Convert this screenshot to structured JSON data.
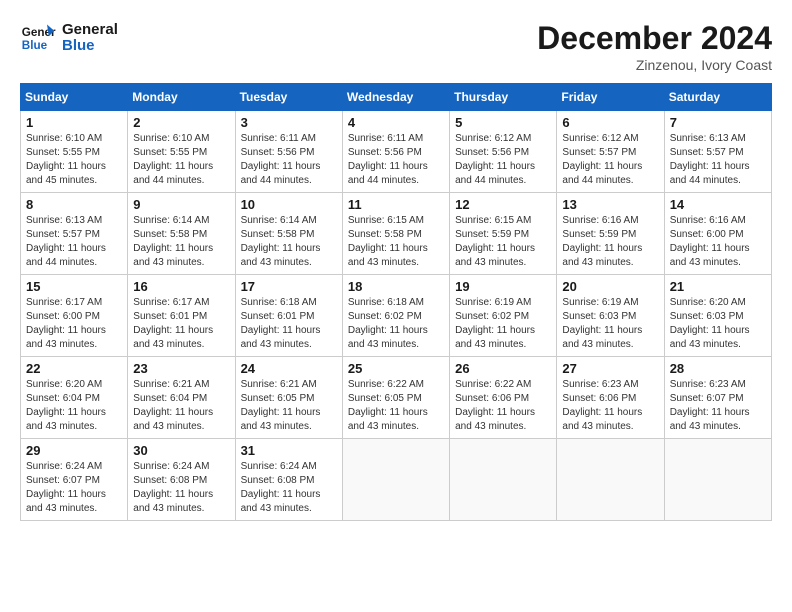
{
  "header": {
    "logo_line1": "General",
    "logo_line2": "Blue",
    "month_title": "December 2024",
    "subtitle": "Zinzenou, Ivory Coast"
  },
  "days_of_week": [
    "Sunday",
    "Monday",
    "Tuesday",
    "Wednesday",
    "Thursday",
    "Friday",
    "Saturday"
  ],
  "weeks": [
    [
      {
        "day": "1",
        "sunrise": "6:10 AM",
        "sunset": "5:55 PM",
        "daylight": "11 hours and 45 minutes."
      },
      {
        "day": "2",
        "sunrise": "6:10 AM",
        "sunset": "5:55 PM",
        "daylight": "11 hours and 44 minutes."
      },
      {
        "day": "3",
        "sunrise": "6:11 AM",
        "sunset": "5:56 PM",
        "daylight": "11 hours and 44 minutes."
      },
      {
        "day": "4",
        "sunrise": "6:11 AM",
        "sunset": "5:56 PM",
        "daylight": "11 hours and 44 minutes."
      },
      {
        "day": "5",
        "sunrise": "6:12 AM",
        "sunset": "5:56 PM",
        "daylight": "11 hours and 44 minutes."
      },
      {
        "day": "6",
        "sunrise": "6:12 AM",
        "sunset": "5:57 PM",
        "daylight": "11 hours and 44 minutes."
      },
      {
        "day": "7",
        "sunrise": "6:13 AM",
        "sunset": "5:57 PM",
        "daylight": "11 hours and 44 minutes."
      }
    ],
    [
      {
        "day": "8",
        "sunrise": "6:13 AM",
        "sunset": "5:57 PM",
        "daylight": "11 hours and 44 minutes."
      },
      {
        "day": "9",
        "sunrise": "6:14 AM",
        "sunset": "5:58 PM",
        "daylight": "11 hours and 43 minutes."
      },
      {
        "day": "10",
        "sunrise": "6:14 AM",
        "sunset": "5:58 PM",
        "daylight": "11 hours and 43 minutes."
      },
      {
        "day": "11",
        "sunrise": "6:15 AM",
        "sunset": "5:58 PM",
        "daylight": "11 hours and 43 minutes."
      },
      {
        "day": "12",
        "sunrise": "6:15 AM",
        "sunset": "5:59 PM",
        "daylight": "11 hours and 43 minutes."
      },
      {
        "day": "13",
        "sunrise": "6:16 AM",
        "sunset": "5:59 PM",
        "daylight": "11 hours and 43 minutes."
      },
      {
        "day": "14",
        "sunrise": "6:16 AM",
        "sunset": "6:00 PM",
        "daylight": "11 hours and 43 minutes."
      }
    ],
    [
      {
        "day": "15",
        "sunrise": "6:17 AM",
        "sunset": "6:00 PM",
        "daylight": "11 hours and 43 minutes."
      },
      {
        "day": "16",
        "sunrise": "6:17 AM",
        "sunset": "6:01 PM",
        "daylight": "11 hours and 43 minutes."
      },
      {
        "day": "17",
        "sunrise": "6:18 AM",
        "sunset": "6:01 PM",
        "daylight": "11 hours and 43 minutes."
      },
      {
        "day": "18",
        "sunrise": "6:18 AM",
        "sunset": "6:02 PM",
        "daylight": "11 hours and 43 minutes."
      },
      {
        "day": "19",
        "sunrise": "6:19 AM",
        "sunset": "6:02 PM",
        "daylight": "11 hours and 43 minutes."
      },
      {
        "day": "20",
        "sunrise": "6:19 AM",
        "sunset": "6:03 PM",
        "daylight": "11 hours and 43 minutes."
      },
      {
        "day": "21",
        "sunrise": "6:20 AM",
        "sunset": "6:03 PM",
        "daylight": "11 hours and 43 minutes."
      }
    ],
    [
      {
        "day": "22",
        "sunrise": "6:20 AM",
        "sunset": "6:04 PM",
        "daylight": "11 hours and 43 minutes."
      },
      {
        "day": "23",
        "sunrise": "6:21 AM",
        "sunset": "6:04 PM",
        "daylight": "11 hours and 43 minutes."
      },
      {
        "day": "24",
        "sunrise": "6:21 AM",
        "sunset": "6:05 PM",
        "daylight": "11 hours and 43 minutes."
      },
      {
        "day": "25",
        "sunrise": "6:22 AM",
        "sunset": "6:05 PM",
        "daylight": "11 hours and 43 minutes."
      },
      {
        "day": "26",
        "sunrise": "6:22 AM",
        "sunset": "6:06 PM",
        "daylight": "11 hours and 43 minutes."
      },
      {
        "day": "27",
        "sunrise": "6:23 AM",
        "sunset": "6:06 PM",
        "daylight": "11 hours and 43 minutes."
      },
      {
        "day": "28",
        "sunrise": "6:23 AM",
        "sunset": "6:07 PM",
        "daylight": "11 hours and 43 minutes."
      }
    ],
    [
      {
        "day": "29",
        "sunrise": "6:24 AM",
        "sunset": "6:07 PM",
        "daylight": "11 hours and 43 minutes."
      },
      {
        "day": "30",
        "sunrise": "6:24 AM",
        "sunset": "6:08 PM",
        "daylight": "11 hours and 43 minutes."
      },
      {
        "day": "31",
        "sunrise": "6:24 AM",
        "sunset": "6:08 PM",
        "daylight": "11 hours and 43 minutes."
      },
      null,
      null,
      null,
      null
    ]
  ]
}
